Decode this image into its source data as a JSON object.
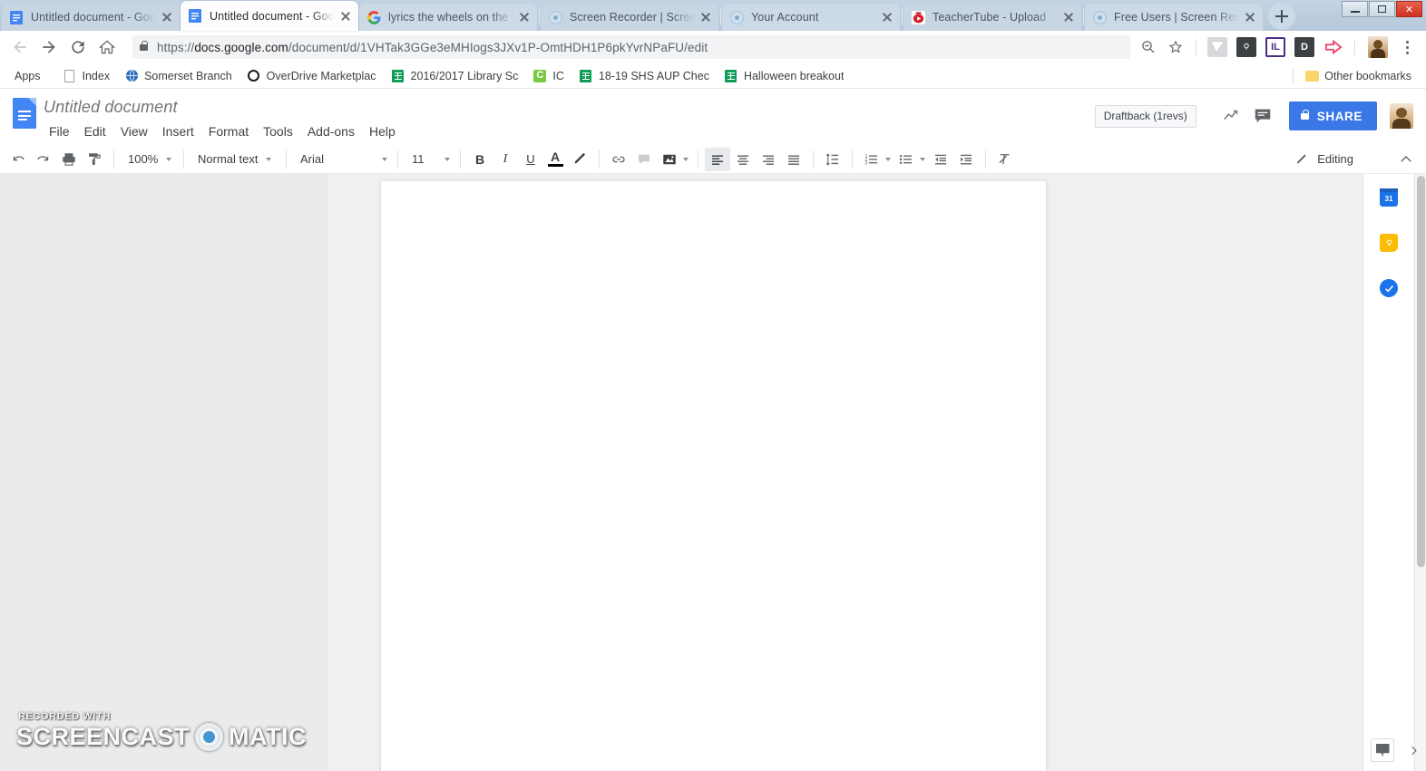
{
  "window": {
    "controls": [
      {
        "name": "minimize-button",
        "label": "—"
      },
      {
        "name": "restore-button",
        "label": "❐"
      },
      {
        "name": "close-button",
        "label": "✕"
      }
    ]
  },
  "tabs": [
    {
      "title": "Untitled document - Goo",
      "favicon": "docs-icon",
      "active": false
    },
    {
      "title": "Untitled document - Goo",
      "favicon": "docs-icon",
      "active": true
    },
    {
      "title": "lyrics the wheels on the b",
      "favicon": "google-icon",
      "active": false
    },
    {
      "title": "Screen Recorder | Screen",
      "favicon": "som-icon",
      "active": false
    },
    {
      "title": "Your Account",
      "favicon": "som-icon",
      "active": false
    },
    {
      "title": "TeacherTube - Upload",
      "favicon": "teachertube-icon",
      "active": false
    },
    {
      "title": "Free Users | Screen Reco",
      "favicon": "som-icon",
      "active": false
    }
  ],
  "newtab_label": "+",
  "omnibox": {
    "back_icon": "arrow-left-icon",
    "forward_icon": "arrow-right-icon",
    "reload_icon": "reload-icon",
    "home_icon": "home-icon",
    "secure_icon": "lock-icon",
    "url_scheme": "https://",
    "url_host": "docs.google.com",
    "url_path": "/document/d/1VHTak3GGe3eMHIogs3JXv1P-OmtHDH1P6pkYvrNPaFU/edit",
    "url_full": "https://docs.google.com/document/d/1VHTak3GGe3eMHIogs3JXv1P-OmtHDH1P6pkYvrNPaFU/edit",
    "zoom_out_icon": "zoom-out-icon",
    "bookmark_icon": "star-icon",
    "extensions": [
      {
        "name": "grammarly-extension-icon",
        "label": "G"
      },
      {
        "name": "keep-extension-icon",
        "label": "K"
      },
      {
        "name": "il-extension-icon",
        "label": "IL"
      },
      {
        "name": "d-extension-icon",
        "label": "D"
      },
      {
        "name": "pink-arrow-extension-icon",
        "label": "➪"
      }
    ],
    "profile_icon": "profile-avatar",
    "menu_icon": "kebab-menu-icon"
  },
  "bookmarks": {
    "apps_label": "Apps",
    "items": [
      {
        "label": "Index",
        "icon": "page-icon"
      },
      {
        "label": "Somerset Branch",
        "icon": "globe-icon"
      },
      {
        "label": "OverDrive Marketplac",
        "icon": "overdrive-icon"
      },
      {
        "label": "2016/2017 Library Sc",
        "icon": "sheets-icon"
      },
      {
        "label": "IC",
        "icon": "ic-icon"
      },
      {
        "label": "18-19 SHS AUP Chec",
        "icon": "sheets-icon"
      },
      {
        "label": "Halloween breakout",
        "icon": "sheets-icon"
      }
    ],
    "other_label": "Other bookmarks",
    "other_icon": "folder-icon"
  },
  "docs": {
    "logo_icon": "google-docs-logo",
    "title": "Untitled document",
    "menus": [
      "File",
      "Edit",
      "View",
      "Insert",
      "Format",
      "Tools",
      "Add-ons",
      "Help"
    ],
    "draftback_label": "Draftback (1revs)",
    "activity_icon": "trending-line-icon",
    "comments_icon": "comment-icon",
    "share_label": "SHARE",
    "share_lock_icon": "lock-icon",
    "avatar_name": "user-avatar"
  },
  "toolbar": {
    "undo_icon": "undo-icon",
    "redo_icon": "redo-icon",
    "print_icon": "print-icon",
    "paint_format_icon": "paint-format-icon",
    "zoom_value": "100%",
    "style_value": "Normal text",
    "font_value": "Arial",
    "size_value": "11",
    "bold_label": "B",
    "italic_label": "I",
    "underline_label": "U",
    "text_color_label": "A",
    "text_color_hex": "#000000",
    "highlight_icon": "highlight-pen-icon",
    "link_icon": "insert-link-icon",
    "comment_icon": "add-comment-icon",
    "image_icon": "insert-image-icon",
    "align_left_icon": "align-left-icon",
    "align_center_icon": "align-center-icon",
    "align_right_icon": "align-right-icon",
    "align_justify_icon": "align-justify-icon",
    "line_spacing_icon": "line-spacing-icon",
    "numbered_list_icon": "numbered-list-icon",
    "bulleted_list_icon": "bulleted-list-icon",
    "decrease_indent_icon": "decrease-indent-icon",
    "increase_indent_icon": "increase-indent-icon",
    "clear_format_icon": "clear-formatting-icon",
    "mode_label": "Editing",
    "mode_icon": "pencil-icon",
    "hide_menus_icon": "chevron-up-icon"
  },
  "sidepanel": {
    "calendar_label": "31",
    "calendar_icon": "google-calendar-icon",
    "keep_icon": "google-keep-icon",
    "tasks_icon": "google-tasks-icon",
    "explore_icon": "explore-icon",
    "collapse_icon": "chevron-right-icon"
  },
  "document_body": {
    "content": ""
  },
  "watermark": {
    "line1": "RECORDED WITH",
    "word1": "SCREENCAST",
    "word2": "MATIC",
    "accent_hex": "#4596cf"
  }
}
